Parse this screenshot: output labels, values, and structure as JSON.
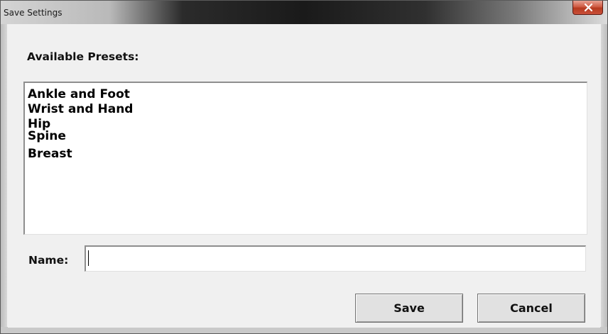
{
  "window": {
    "title": "Save Settings",
    "close_icon": "close-x-icon"
  },
  "presets": {
    "label": "Available Presets:",
    "items": [
      "Ankle and Foot",
      "Wrist and Hand",
      "Hip",
      "Spine",
      "Breast"
    ]
  },
  "name_field": {
    "label": "Name:",
    "value": ""
  },
  "buttons": {
    "save_label": "Save",
    "cancel_label": "Cancel"
  },
  "colors": {
    "close_button": "#c9503a",
    "dialog_background": "#f0f0f0"
  }
}
